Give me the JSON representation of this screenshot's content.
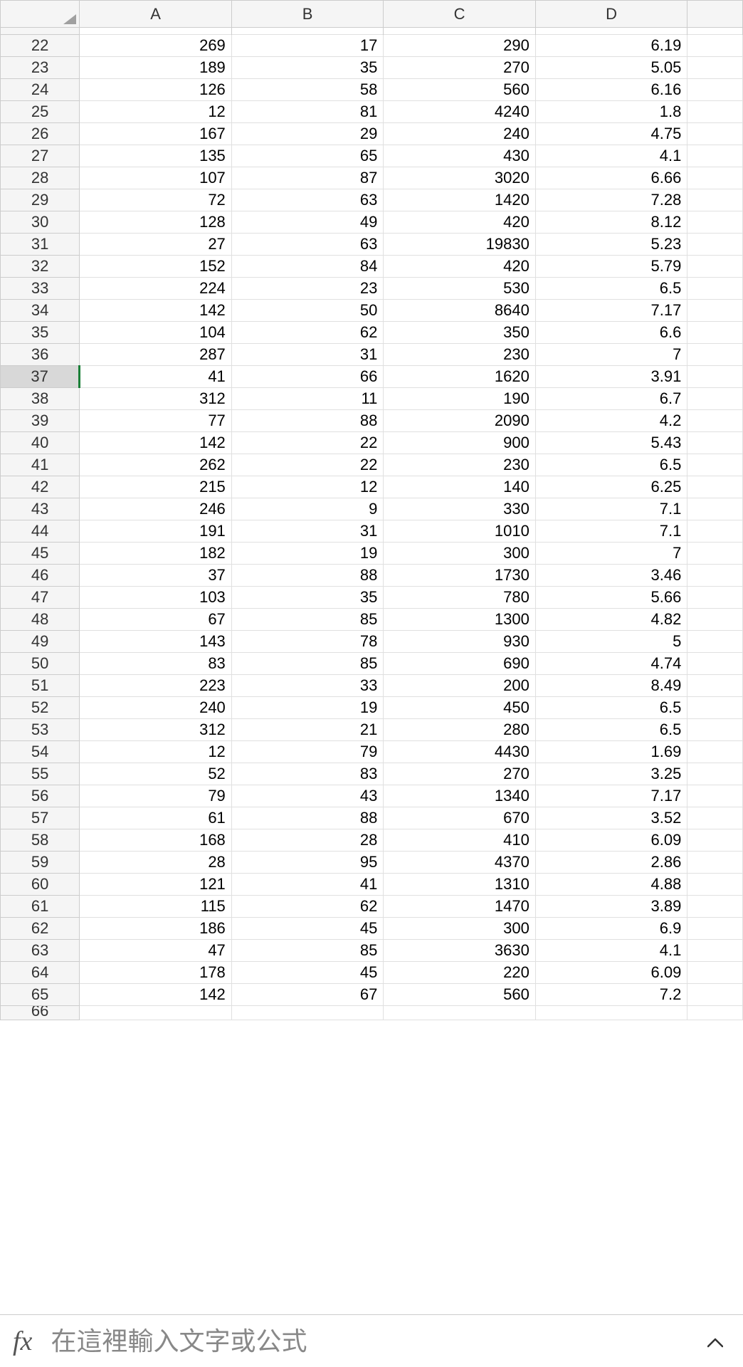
{
  "columns": [
    "A",
    "B",
    "C",
    "D"
  ],
  "selected_row": 37,
  "partial_row_label": "66",
  "rows": [
    {
      "n": 22,
      "a": "269",
      "b": "17",
      "c": "290",
      "d": "6.19"
    },
    {
      "n": 23,
      "a": "189",
      "b": "35",
      "c": "270",
      "d": "5.05"
    },
    {
      "n": 24,
      "a": "126",
      "b": "58",
      "c": "560",
      "d": "6.16"
    },
    {
      "n": 25,
      "a": "12",
      "b": "81",
      "c": "4240",
      "d": "1.8"
    },
    {
      "n": 26,
      "a": "167",
      "b": "29",
      "c": "240",
      "d": "4.75"
    },
    {
      "n": 27,
      "a": "135",
      "b": "65",
      "c": "430",
      "d": "4.1"
    },
    {
      "n": 28,
      "a": "107",
      "b": "87",
      "c": "3020",
      "d": "6.66"
    },
    {
      "n": 29,
      "a": "72",
      "b": "63",
      "c": "1420",
      "d": "7.28"
    },
    {
      "n": 30,
      "a": "128",
      "b": "49",
      "c": "420",
      "d": "8.12"
    },
    {
      "n": 31,
      "a": "27",
      "b": "63",
      "c": "19830",
      "d": "5.23"
    },
    {
      "n": 32,
      "a": "152",
      "b": "84",
      "c": "420",
      "d": "5.79"
    },
    {
      "n": 33,
      "a": "224",
      "b": "23",
      "c": "530",
      "d": "6.5"
    },
    {
      "n": 34,
      "a": "142",
      "b": "50",
      "c": "8640",
      "d": "7.17"
    },
    {
      "n": 35,
      "a": "104",
      "b": "62",
      "c": "350",
      "d": "6.6"
    },
    {
      "n": 36,
      "a": "287",
      "b": "31",
      "c": "230",
      "d": "7"
    },
    {
      "n": 37,
      "a": "41",
      "b": "66",
      "c": "1620",
      "d": "3.91"
    },
    {
      "n": 38,
      "a": "312",
      "b": "11",
      "c": "190",
      "d": "6.7"
    },
    {
      "n": 39,
      "a": "77",
      "b": "88",
      "c": "2090",
      "d": "4.2"
    },
    {
      "n": 40,
      "a": "142",
      "b": "22",
      "c": "900",
      "d": "5.43"
    },
    {
      "n": 41,
      "a": "262",
      "b": "22",
      "c": "230",
      "d": "6.5"
    },
    {
      "n": 42,
      "a": "215",
      "b": "12",
      "c": "140",
      "d": "6.25"
    },
    {
      "n": 43,
      "a": "246",
      "b": "9",
      "c": "330",
      "d": "7.1"
    },
    {
      "n": 44,
      "a": "191",
      "b": "31",
      "c": "1010",
      "d": "7.1"
    },
    {
      "n": 45,
      "a": "182",
      "b": "19",
      "c": "300",
      "d": "7"
    },
    {
      "n": 46,
      "a": "37",
      "b": "88",
      "c": "1730",
      "d": "3.46"
    },
    {
      "n": 47,
      "a": "103",
      "b": "35",
      "c": "780",
      "d": "5.66"
    },
    {
      "n": 48,
      "a": "67",
      "b": "85",
      "c": "1300",
      "d": "4.82"
    },
    {
      "n": 49,
      "a": "143",
      "b": "78",
      "c": "930",
      "d": "5"
    },
    {
      "n": 50,
      "a": "83",
      "b": "85",
      "c": "690",
      "d": "4.74"
    },
    {
      "n": 51,
      "a": "223",
      "b": "33",
      "c": "200",
      "d": "8.49"
    },
    {
      "n": 52,
      "a": "240",
      "b": "19",
      "c": "450",
      "d": "6.5"
    },
    {
      "n": 53,
      "a": "312",
      "b": "21",
      "c": "280",
      "d": "6.5"
    },
    {
      "n": 54,
      "a": "12",
      "b": "79",
      "c": "4430",
      "d": "1.69"
    },
    {
      "n": 55,
      "a": "52",
      "b": "83",
      "c": "270",
      "d": "3.25"
    },
    {
      "n": 56,
      "a": "79",
      "b": "43",
      "c": "1340",
      "d": "7.17"
    },
    {
      "n": 57,
      "a": "61",
      "b": "88",
      "c": "670",
      "d": "3.52"
    },
    {
      "n": 58,
      "a": "168",
      "b": "28",
      "c": "410",
      "d": "6.09"
    },
    {
      "n": 59,
      "a": "28",
      "b": "95",
      "c": "4370",
      "d": "2.86"
    },
    {
      "n": 60,
      "a": "121",
      "b": "41",
      "c": "1310",
      "d": "4.88"
    },
    {
      "n": 61,
      "a": "115",
      "b": "62",
      "c": "1470",
      "d": "3.89"
    },
    {
      "n": 62,
      "a": "186",
      "b": "45",
      "c": "300",
      "d": "6.9"
    },
    {
      "n": 63,
      "a": "47",
      "b": "85",
      "c": "3630",
      "d": "4.1"
    },
    {
      "n": 64,
      "a": "178",
      "b": "45",
      "c": "220",
      "d": "6.09"
    },
    {
      "n": 65,
      "a": "142",
      "b": "67",
      "c": "560",
      "d": "7.2"
    }
  ],
  "formula_bar": {
    "fx_label": "fx",
    "placeholder": "在這裡輸入文字或公式"
  }
}
